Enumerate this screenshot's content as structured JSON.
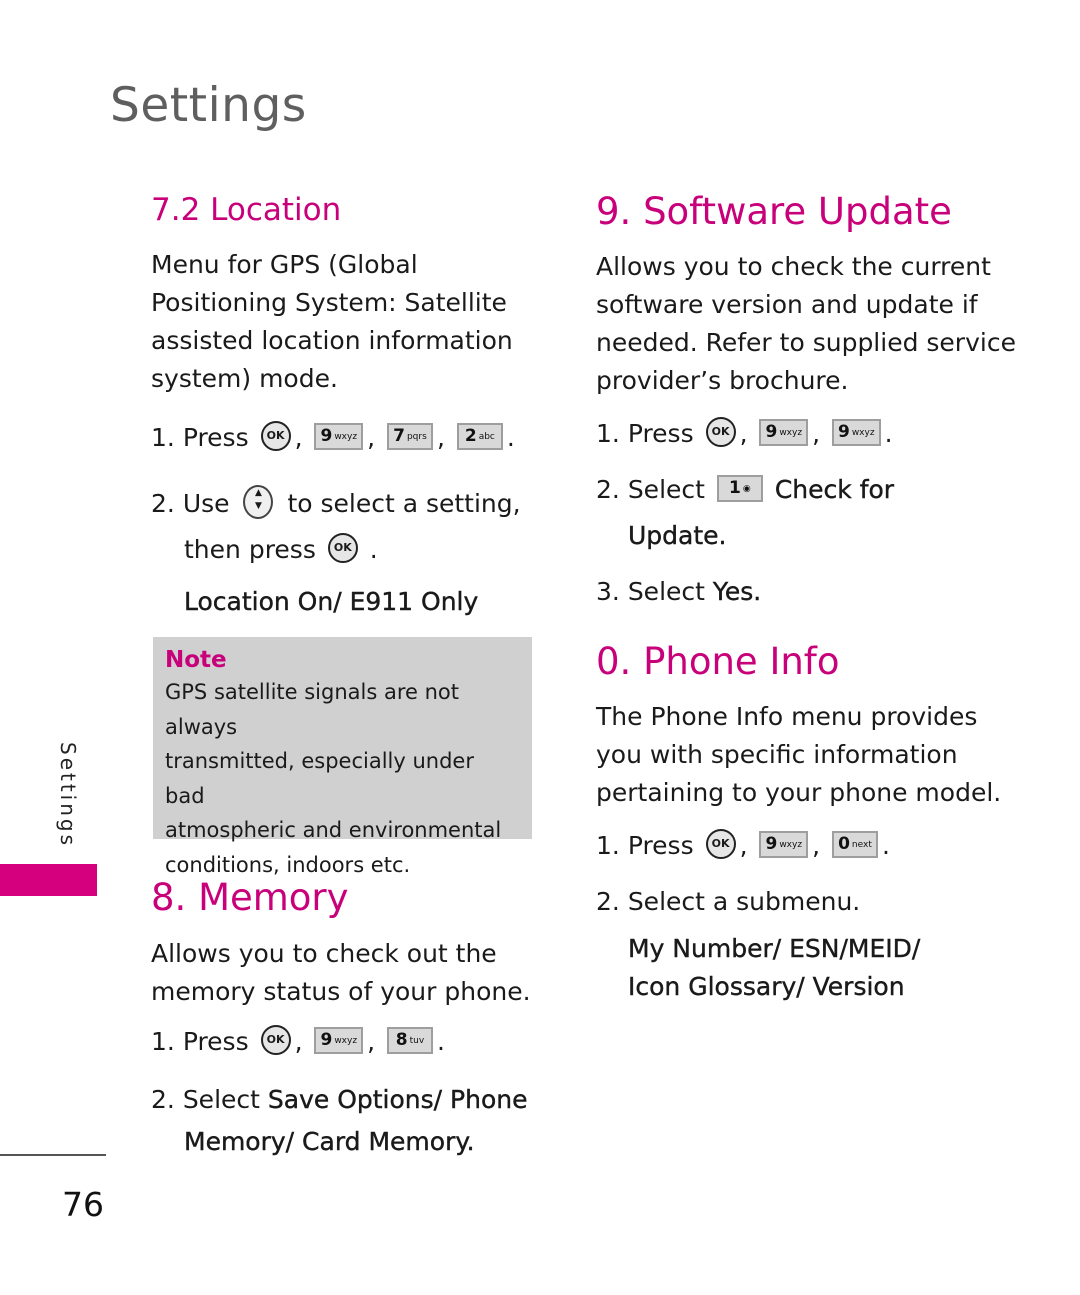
{
  "page": {
    "title": "Settings",
    "side_tab_label": "Settings",
    "page_number": "76",
    "accent_color": "#c8007a"
  },
  "location": {
    "heading": "7.2 Location",
    "description": [
      "Menu for GPS (Global",
      "Positioning System: Satellite",
      "assisted location information",
      "system) mode."
    ],
    "step1": {
      "num": "1.",
      "text": "Press",
      "keys": [
        {
          "type": "ok",
          "label": "OK"
        },
        {
          "type": "key",
          "digit": "9",
          "letters": "wxyz"
        },
        {
          "type": "key",
          "digit": "7",
          "letters": "pqrs"
        },
        {
          "type": "key",
          "digit": "2",
          "letters": "abc"
        }
      ]
    },
    "step2": {
      "num": "2.",
      "text_a": "Use",
      "text_b": "to select a setting,",
      "text_c": "then press",
      "end": "."
    },
    "options": "Location On/ E911 Only",
    "note": {
      "label": "Note",
      "lines": [
        "GPS satellite signals are not always",
        "transmitted, especially under bad",
        "atmospheric and environmental",
        "conditions, indoors etc."
      ]
    }
  },
  "memory": {
    "heading": "8. Memory",
    "description": [
      "Allows you to check out the",
      "memory status of your phone."
    ],
    "step1": {
      "num": "1.",
      "text": "Press",
      "keys": [
        {
          "type": "ok",
          "label": "OK"
        },
        {
          "type": "key",
          "digit": "9",
          "letters": "wxyz"
        },
        {
          "type": "key",
          "digit": "8",
          "letters": "tuv"
        }
      ]
    },
    "step2": {
      "num": "2.",
      "text": "Select",
      "bold_a": "Save Options/ Phone",
      "bold_b": "Memory/ Card Memory."
    }
  },
  "software_update": {
    "heading": "9. Software Update",
    "description": [
      "Allows you to check the current",
      "software version and update if",
      "needed. Refer to supplied service",
      "provider’s brochure."
    ],
    "step1": {
      "num": "1.",
      "text": "Press",
      "keys": [
        {
          "type": "ok",
          "label": "OK"
        },
        {
          "type": "key",
          "digit": "9",
          "letters": "wxyz"
        },
        {
          "type": "key",
          "digit": "9",
          "letters": "wxyz"
        }
      ]
    },
    "step2": {
      "num": "2.",
      "text": "Select",
      "key": {
        "digit": "1",
        "icon": "voicemail-icon"
      },
      "bold_a": "Check for",
      "bold_b": "Update."
    },
    "step3": {
      "num": "3.",
      "text": "Select",
      "bold": "Yes."
    }
  },
  "phone_info": {
    "heading": "0. Phone Info",
    "description": [
      "The Phone Info menu provides",
      "you with specific information",
      "pertaining to your phone model."
    ],
    "step1": {
      "num": "1.",
      "text": "Press",
      "keys": [
        {
          "type": "ok",
          "label": "OK"
        },
        {
          "type": "key",
          "digit": "9",
          "letters": "wxyz"
        },
        {
          "type": "key",
          "digit": "0",
          "letters": "next"
        }
      ]
    },
    "step2": {
      "num": "2.",
      "text": "Select a submenu."
    },
    "submenus": [
      "My Number/ ESN/MEID/",
      "Icon Glossary/ Version"
    ]
  },
  "punct": {
    "comma": ",",
    "period": "."
  }
}
